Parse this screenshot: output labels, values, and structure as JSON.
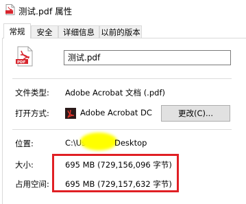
{
  "window": {
    "title": "测试.pdf 属性"
  },
  "tabs": [
    {
      "label": "常规",
      "active": true
    },
    {
      "label": "安全",
      "active": false
    },
    {
      "label": "详细信息",
      "active": false
    },
    {
      "label": "以前的版本",
      "active": false
    }
  ],
  "general": {
    "file_name": "测试.pdf",
    "file_type_label": "文件类型:",
    "file_type_value": "Adobe Acrobat 文档 (.pdf)",
    "open_with_label": "打开方式:",
    "open_with_value": "Adobe Acrobat DC",
    "change_button": "更改(C)...",
    "location_label": "位置:",
    "location_value_start": "C:\\Us",
    "location_value_end": "Desktop",
    "size_label": "大小:",
    "size_value": "695 MB (729,156,096 字节)",
    "size_on_disk_label": "占用空间:",
    "size_on_disk_value": "695 MB (729,157,632 字节)"
  },
  "icons": {
    "title_icon": "pdf-file-icon",
    "file_icon": "pdf-file-icon",
    "app_icon": "acrobat-icon"
  },
  "colors": {
    "highlight_box": "#e01f24",
    "redaction": "#ffff00",
    "pdf_red": "#d7262e"
  }
}
